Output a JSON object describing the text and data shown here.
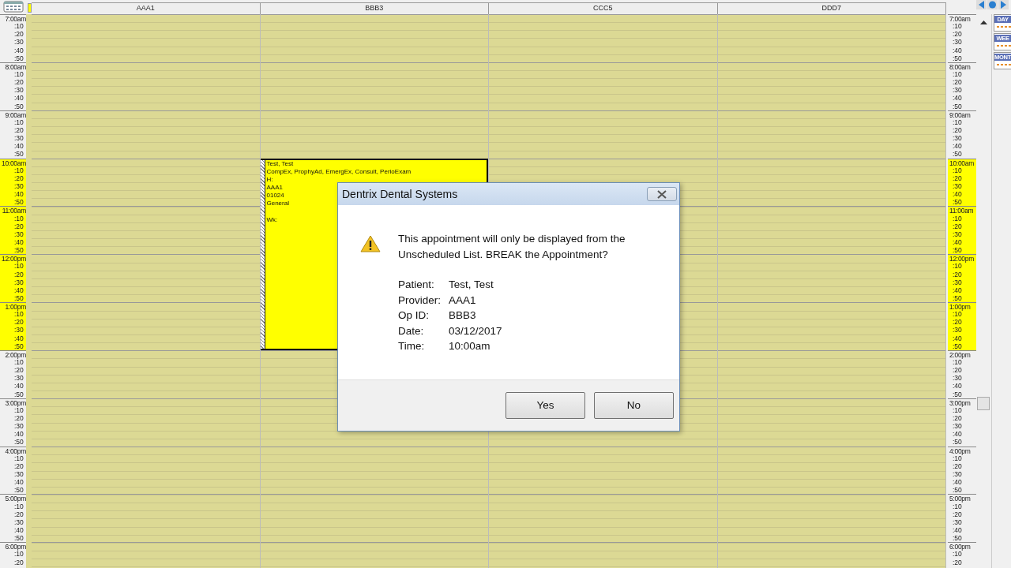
{
  "views": [
    {
      "label": "DAY"
    },
    {
      "label": "WEE"
    },
    {
      "label": "MONT"
    }
  ],
  "columns": [
    {
      "label": "AAA1"
    },
    {
      "label": "BBB3",
      "appointments": [
        {
          "lines": [
            "Test, Test",
            "CompEx, ProphyAd, EmergEx, Consult, PerioExam",
            "H:",
            "AAA1",
            "01024",
            "General"
          ],
          "week": "Wk:"
        }
      ]
    },
    {
      "label": "CCC5"
    },
    {
      "label": "DDD7"
    }
  ],
  "left_times": [
    {
      "label": "7:00am",
      "highlighted": false,
      "minutes": [
        ":10",
        ":20",
        ":30",
        ":40",
        ":50"
      ]
    },
    {
      "label": "8:00am",
      "highlighted": false,
      "minutes": [
        ":10",
        ":20",
        ":30",
        ":40",
        ":50"
      ]
    },
    {
      "label": "9:00am",
      "highlighted": false,
      "minutes": [
        ":10",
        ":20",
        ":30",
        ":40",
        ":50"
      ]
    },
    {
      "label": "10:00am",
      "highlighted": true,
      "minutes": [
        ":10",
        ":20",
        ":30",
        ":40",
        ":50"
      ]
    },
    {
      "label": "11:00am",
      "highlighted": true,
      "minutes": [
        ":10",
        ":20",
        ":30",
        ":40",
        ":50"
      ]
    },
    {
      "label": "12:00pm",
      "highlighted": true,
      "minutes": [
        ":10",
        ":20",
        ":30",
        ":40",
        ":50"
      ]
    },
    {
      "label": "1:00pm",
      "highlighted": true,
      "minutes": [
        ":10",
        ":20",
        ":30",
        ":40",
        ":50"
      ]
    },
    {
      "label": "2:00pm",
      "highlighted": false,
      "minutes": [
        ":10",
        ":20",
        ":30",
        ":40",
        ":50"
      ]
    },
    {
      "label": "3:00pm",
      "highlighted": false,
      "minutes": [
        ":10",
        ":20",
        ":30",
        ":40",
        ":50"
      ]
    },
    {
      "label": "4:00pm",
      "highlighted": false,
      "minutes": [
        ":10",
        ":20",
        ":30",
        ":40",
        ":50"
      ]
    },
    {
      "label": "5:00pm",
      "highlighted": false,
      "minutes": [
        ":10",
        ":20",
        ":30",
        ":40",
        ":50"
      ]
    },
    {
      "label": "6:00pm",
      "highlighted": false,
      "minutes": [
        ":10",
        ":20"
      ]
    }
  ],
  "right_times": [
    {
      "label": "7:00am",
      "highlighted": false,
      "minutes": [
        ":10",
        ":20",
        ":30",
        ":40",
        ":50"
      ]
    },
    {
      "label": "8:00am",
      "highlighted": false,
      "minutes": [
        ":10",
        ":20",
        ":30",
        ":40",
        ":50"
      ]
    },
    {
      "label": "9:00am",
      "highlighted": false,
      "minutes": [
        ":10",
        ":20",
        ":30",
        ":40",
        ":50"
      ]
    },
    {
      "label": "10:00am",
      "highlighted": true,
      "minutes": [
        ":10",
        ":20",
        ":30",
        ":40",
        ":50"
      ]
    },
    {
      "label": "11:00am",
      "highlighted": true,
      "minutes": [
        ":10",
        ":20",
        ":30",
        ":40",
        ":50"
      ]
    },
    {
      "label": "12:00pm",
      "highlighted": true,
      "minutes": [
        ":10",
        ":20",
        ":30",
        ":40",
        ":50"
      ]
    },
    {
      "label": "1:00pm",
      "highlighted": true,
      "minutes": [
        ":10",
        ":20",
        ":30",
        ":40",
        ":50"
      ]
    },
    {
      "label": "2:00pm",
      "highlighted": false,
      "minutes": [
        ":10",
        ":20",
        ":30",
        ":40",
        ":50"
      ]
    },
    {
      "label": "3:00pm",
      "highlighted": false,
      "minutes": [
        ":10",
        ":20",
        ":30",
        ":40",
        ":50"
      ]
    },
    {
      "label": "4:00pm",
      "highlighted": false,
      "minutes": [
        ":10",
        ":20",
        ":30",
        ":40",
        ":50"
      ]
    },
    {
      "label": "5:00pm",
      "highlighted": false,
      "minutes": [
        ":10",
        ":20",
        ":30",
        ":40",
        ":50"
      ]
    },
    {
      "label": "6:00pm",
      "highlighted": false,
      "minutes": [
        ":10",
        ":20"
      ]
    }
  ],
  "dialog": {
    "title": "Dentrix Dental Systems",
    "message": "This appointment will only be displayed from the Unscheduled List. BREAK the Appointment?",
    "details": [
      {
        "label": "Patient:",
        "value": "Test, Test"
      },
      {
        "label": "Provider:",
        "value": "AAA1"
      },
      {
        "label": "Op ID:",
        "value": "BBB3"
      },
      {
        "label": "Date:",
        "value": "03/12/2017"
      },
      {
        "label": "Time:",
        "value": "10:00am"
      }
    ],
    "buttons": [
      {
        "label": "Yes"
      },
      {
        "label": "No"
      }
    ]
  }
}
